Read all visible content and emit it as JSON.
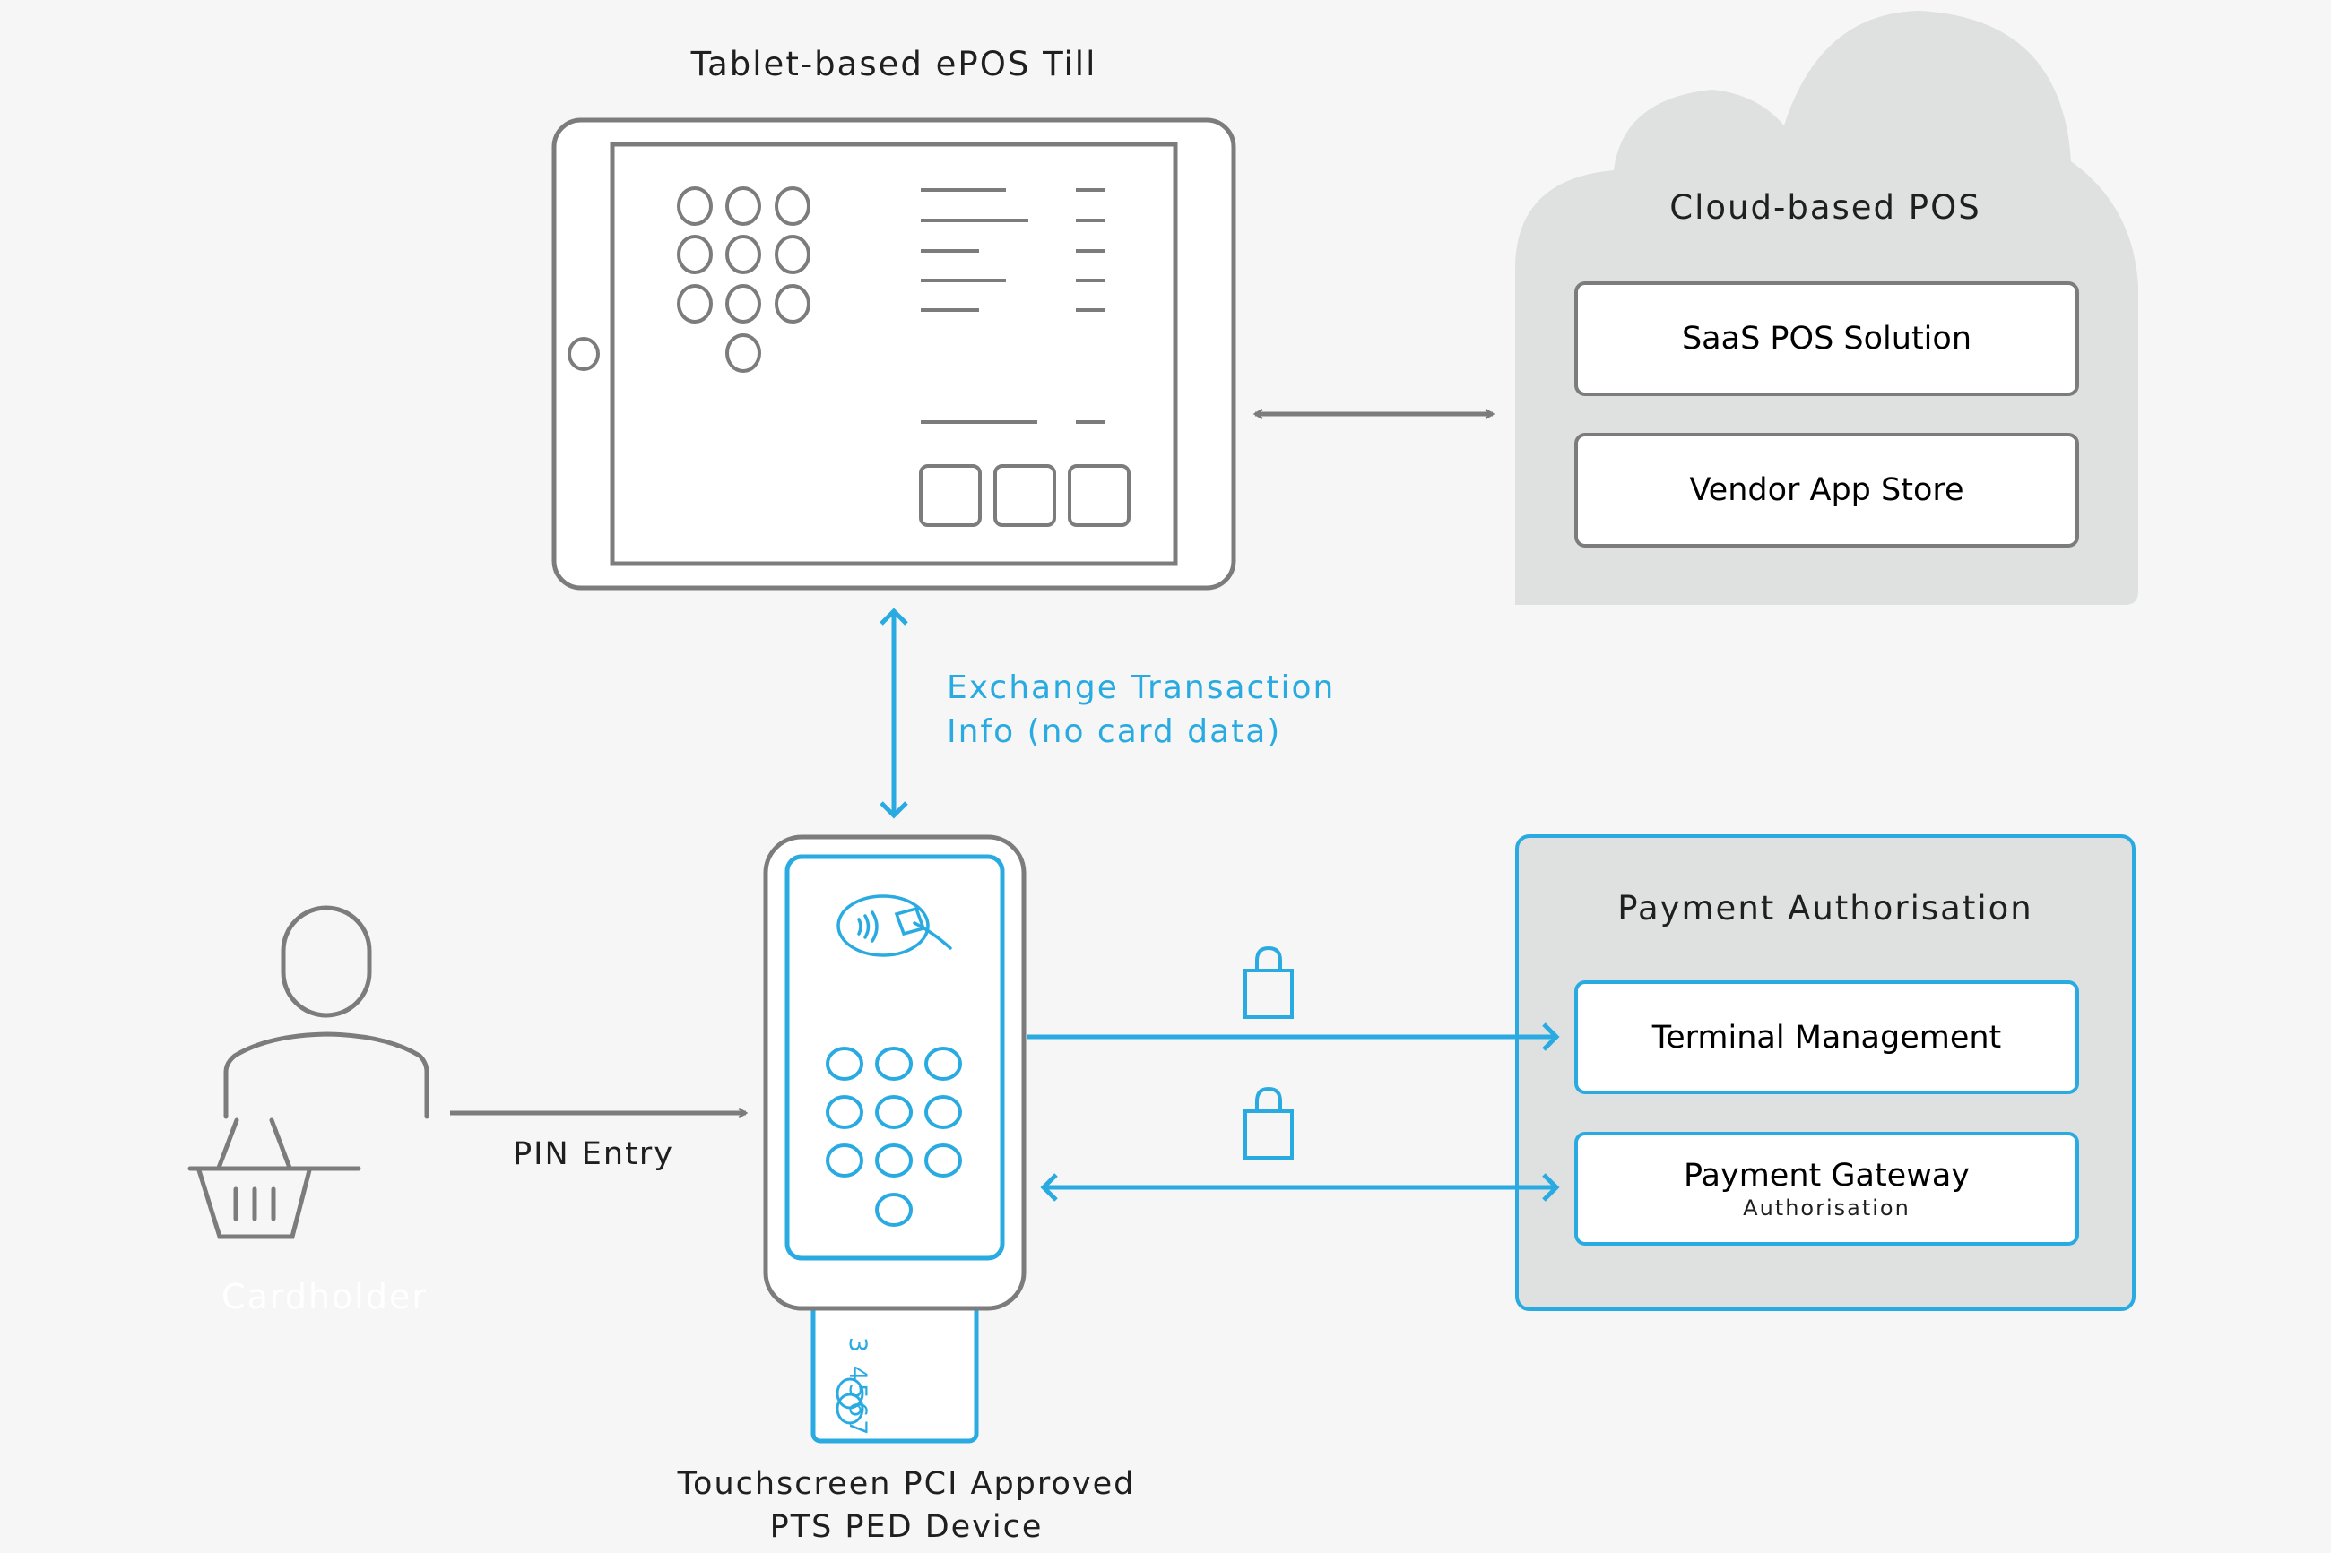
{
  "tablet": {
    "title": "Tablet-based ePOS Till"
  },
  "cloud": {
    "title": "Cloud-based POS",
    "items": [
      {
        "label": "SaaS POS Solution"
      },
      {
        "label": "Vendor App Store"
      }
    ]
  },
  "exchange_link": {
    "label_line1": "Exchange Transaction",
    "label_line2": "Info (no card data)"
  },
  "cardholder": {
    "label": "Cardholder",
    "link_label": "PIN Entry"
  },
  "ped_device": {
    "caption_line1": "Touchscreen PCI Approved",
    "caption_line2": "PTS PED Device",
    "card_number": "3 4567"
  },
  "payment_auth": {
    "title": "Payment Authorisation",
    "items": [
      {
        "label": "Terminal Management",
        "sublabel": ""
      },
      {
        "label": "Payment Gateway",
        "sublabel": "Authorisation"
      }
    ]
  },
  "colors": {
    "accent_blue": "#29abe2",
    "line_grey": "#7c7c7c",
    "panel_grey": "#dfe0e0",
    "background": "#f6f6f6"
  }
}
